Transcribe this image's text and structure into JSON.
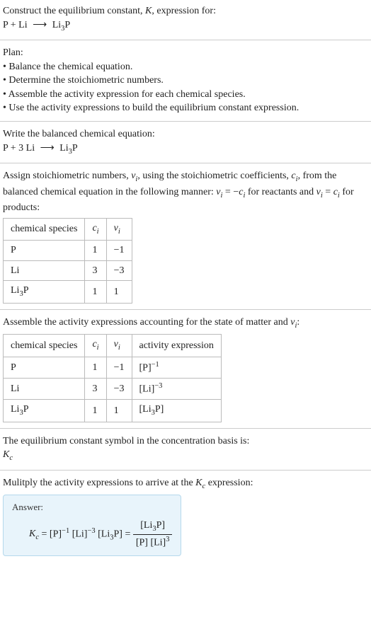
{
  "header": {
    "line1": "Construct the equilibrium constant, K, expression for:",
    "reaction_unbalanced": "P + Li ⟶ Li₃P"
  },
  "plan": {
    "title": "Plan:",
    "items": [
      "Balance the chemical equation.",
      "Determine the stoichiometric numbers.",
      "Assemble the activity expression for each chemical species.",
      "Use the activity expressions to build the equilibrium constant expression."
    ]
  },
  "balanced": {
    "title": "Write the balanced chemical equation:",
    "reaction": "P + 3 Li ⟶ Li₃P"
  },
  "stoich": {
    "intro_a": "Assign stoichiometric numbers, νᵢ, using the stoichiometric coefficients, cᵢ, from the balanced chemical equation in the following manner: νᵢ = −cᵢ for reactants and νᵢ = cᵢ for products:",
    "table": {
      "headers": [
        "chemical species",
        "cᵢ",
        "νᵢ"
      ],
      "rows": [
        {
          "species": "P",
          "c": "1",
          "v": "−1"
        },
        {
          "species": "Li",
          "c": "3",
          "v": "−3"
        },
        {
          "species": "Li₃P",
          "c": "1",
          "v": "1"
        }
      ]
    }
  },
  "activity": {
    "intro": "Assemble the activity expressions accounting for the state of matter and νᵢ:",
    "table": {
      "headers": [
        "chemical species",
        "cᵢ",
        "νᵢ",
        "activity expression"
      ],
      "rows": [
        {
          "species": "P",
          "c": "1",
          "v": "−1",
          "expr": "[P]⁻¹"
        },
        {
          "species": "Li",
          "c": "3",
          "v": "−3",
          "expr": "[Li]⁻³"
        },
        {
          "species": "Li₃P",
          "c": "1",
          "v": "1",
          "expr": "[Li₃P]"
        }
      ]
    }
  },
  "kc_symbol": {
    "intro": "The equilibrium constant symbol in the concentration basis is:",
    "symbol": "K_c"
  },
  "multiply": {
    "intro": "Mulitply the activity expressions to arrive at the K_c expression:"
  },
  "answer": {
    "label": "Answer:",
    "lhs": "K_c = [P]⁻¹ [Li]⁻³ [Li₃P] =",
    "frac_num": "[Li₃P]",
    "frac_den": "[P] [Li]³"
  }
}
